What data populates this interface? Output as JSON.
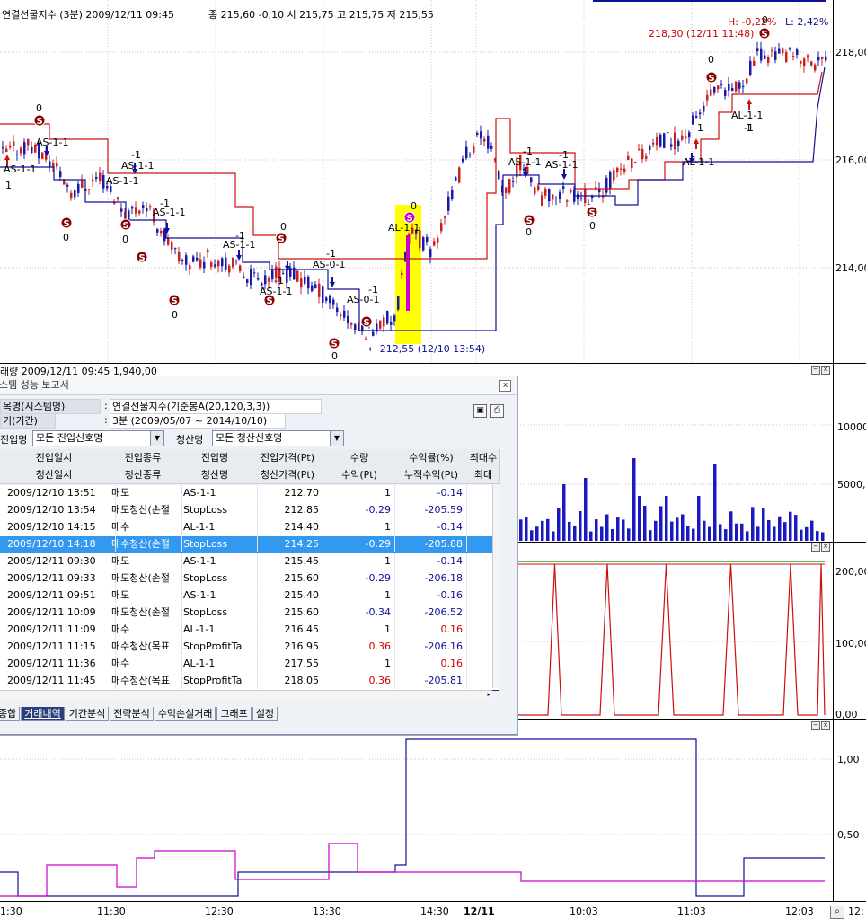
{
  "chart_header": {
    "title": "연결선물지수 (3분) 2009/12/11 09:45",
    "ohlc": "종 215,60 -0,10   시 215,75 고 215,75 저 215,55"
  },
  "chart_right_info": {
    "high_label": "H: -0,22%",
    "low_label": "L: 2,42%",
    "max_label": "218,30 (12/11 11:48)",
    "min_label": "212,55 (12/10 13:54)"
  },
  "price_axis": [
    "218,00",
    "216,00",
    "214,00"
  ],
  "volume_header": "래량  2009/12/11 09:45 1,940,00",
  "volume_axis": [
    "10000",
    "5000,0"
  ],
  "pane3_axis": [
    "200,00",
    "100,00",
    "0,00"
  ],
  "pane4_axis": [
    "1,00",
    "0,50"
  ],
  "time_axis": [
    "1:30",
    "11:30",
    "12:30",
    "13:30",
    "14:30",
    "12/11",
    "10:03",
    "11:03",
    "12:03",
    "12:"
  ],
  "signals": {
    "labels": [
      "AS-1-1",
      "AS-1-1",
      "AS-1-1",
      "AS-1-1",
      "AS-1-1",
      "AS-1-1",
      "AS-1-1",
      "AS-0-1",
      "AL-1-1",
      "AS-1-1",
      "AS-1-1",
      "AL-1-1",
      "AL-1-1"
    ],
    "zero": "0",
    "minus_one": "-1",
    "one": "1",
    "stop_glyph": "S"
  },
  "dialog": {
    "title": "스템 성능 보고서",
    "close": "x",
    "system_key": "목명(시스템명)",
    "system_val": "연결선물지수(기준봉A(20,120,3,3))",
    "period_key": "기(기간)",
    "period_val": "3분 (2009/05/07 ~ 2014/10/10)",
    "entry_label": "진입명",
    "entry_combo": "모든 진입신호명",
    "exit_label": "청산명",
    "exit_combo": "모든 청산신호명",
    "headers_top": [
      "진입일시",
      "진입종류",
      "진입명",
      "진입가격(Pt)",
      "수량",
      "수익률(%)",
      "최대수"
    ],
    "headers_bottom": [
      "청산일시",
      "청산종류",
      "청산명",
      "청산가격(Pt)",
      "수익(Pt)",
      "누적수익(Pt)",
      "최대"
    ],
    "rows": [
      {
        "date": "2009/12/10 13:51",
        "type": "매도",
        "name": "AS-1-1",
        "price": "212.70",
        "qty": "1",
        "pct": "-0.14"
      },
      {
        "date": "2009/12/10 13:54",
        "type": "매도청산(손절",
        "name": "StopLoss",
        "price": "212.85",
        "qty": "-0.29",
        "pct": "-205.59"
      },
      {
        "date": "2009/12/10 14:15",
        "type": "매수",
        "name": "AL-1-1",
        "price": "214.40",
        "qty": "1",
        "pct": "-0.14"
      },
      {
        "date": "2009/12/10 14:18",
        "type": "매수청산(손절",
        "name": "StopLoss",
        "price": "214.25",
        "qty": "-0.29",
        "pct": "-205.88"
      },
      {
        "date": "2009/12/11 09:30",
        "type": "매도",
        "name": "AS-1-1",
        "price": "215.45",
        "qty": "1",
        "pct": "-0.14"
      },
      {
        "date": "2009/12/11 09:33",
        "type": "매도청산(손절",
        "name": "StopLoss",
        "price": "215.60",
        "qty": "-0.29",
        "pct": "-206.18"
      },
      {
        "date": "2009/12/11 09:51",
        "type": "매도",
        "name": "AS-1-1",
        "price": "215.40",
        "qty": "1",
        "pct": "-0.16"
      },
      {
        "date": "2009/12/11 10:09",
        "type": "매도청산(손절",
        "name": "StopLoss",
        "price": "215.60",
        "qty": "-0.34",
        "pct": "-206.52"
      },
      {
        "date": "2009/12/11 11:09",
        "type": "매수",
        "name": "AL-1-1",
        "price": "216.45",
        "qty": "1",
        "pct": "0.16"
      },
      {
        "date": "2009/12/11 11:15",
        "type": "매수청산(목표",
        "name": "StopProfitTa",
        "price": "216.95",
        "qty": "0.36",
        "pct": "-206.16"
      },
      {
        "date": "2009/12/11 11:36",
        "type": "매수",
        "name": "AL-1-1",
        "price": "217.55",
        "qty": "1",
        "pct": "0.16"
      },
      {
        "date": "2009/12/11 11:45",
        "type": "매수청산(목표",
        "name": "StopProfitTa",
        "price": "218.05",
        "qty": "0.36",
        "pct": "-205.81"
      }
    ],
    "tabs": [
      "종합",
      "거래내역",
      "기간분석",
      "전략분석",
      "수익손실거래",
      "그래프",
      "설정"
    ],
    "active_tab": "거래내역"
  },
  "colors": {
    "up_candle": "#cc2020",
    "down_candle": "#1a1aa8",
    "stop_line_red": "#cc1010",
    "stop_line_blue": "#10109a",
    "highlight": "#ffff00",
    "selected_row": "#3399ee",
    "magenta": "#cc00cc"
  }
}
